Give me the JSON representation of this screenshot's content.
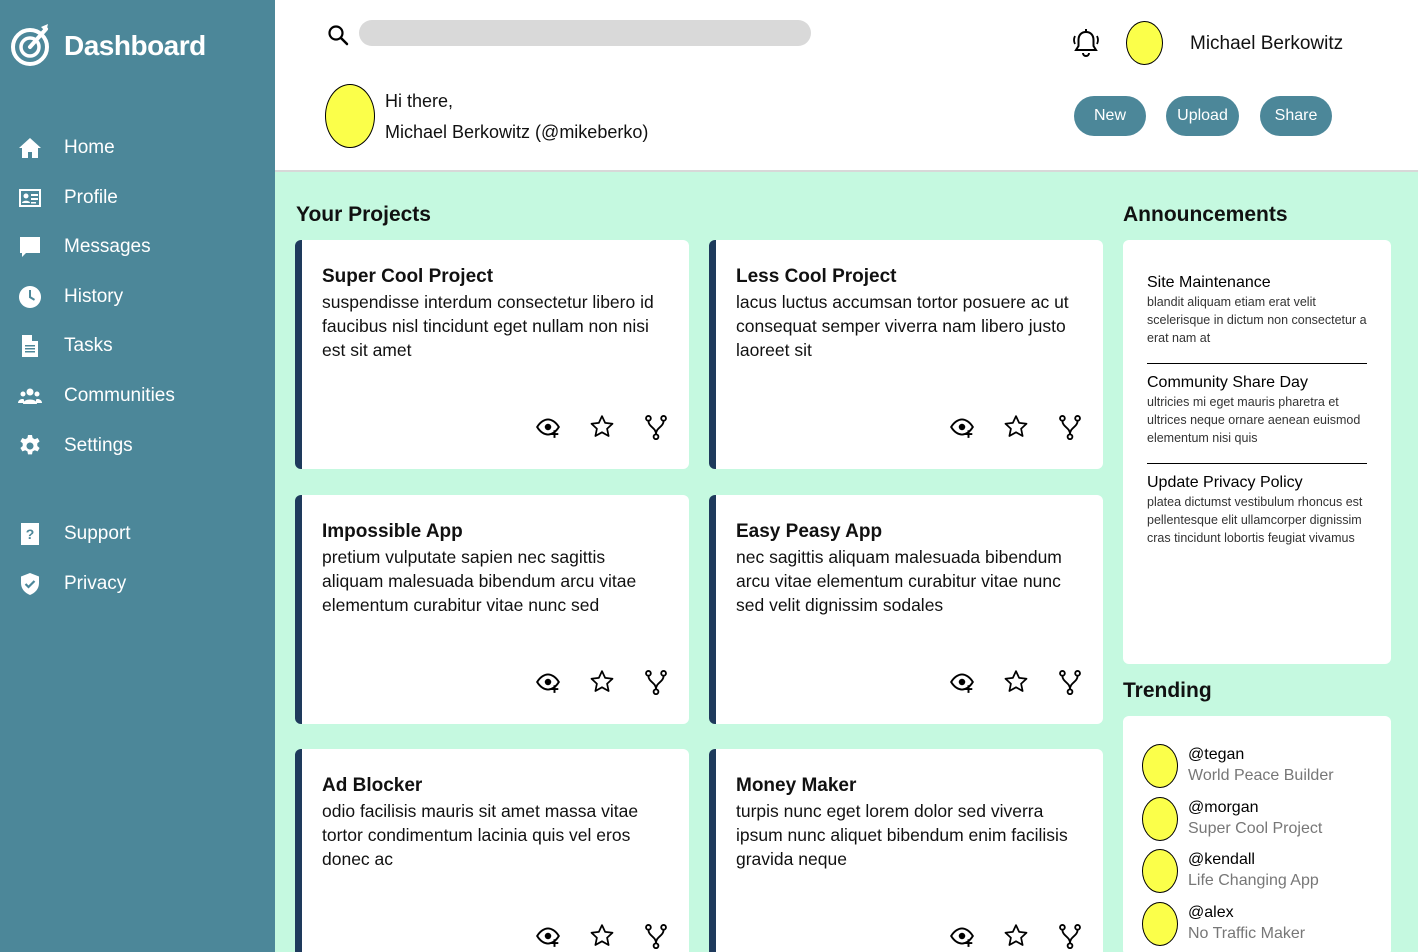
{
  "brand": {
    "title": "Dashboard"
  },
  "sidebar": {
    "main": [
      {
        "label": "Home",
        "icon": "home-icon"
      },
      {
        "label": "Profile",
        "icon": "profile-card-icon"
      },
      {
        "label": "Messages",
        "icon": "message-icon"
      },
      {
        "label": "History",
        "icon": "clock-icon"
      },
      {
        "label": "Tasks",
        "icon": "document-icon"
      },
      {
        "label": "Communities",
        "icon": "people-icon"
      },
      {
        "label": "Settings",
        "icon": "gear-icon"
      }
    ],
    "secondary": [
      {
        "label": "Support",
        "icon": "question-icon"
      },
      {
        "label": "Privacy",
        "icon": "shield-check-icon"
      }
    ]
  },
  "header": {
    "search_value": "",
    "user_name": "Michael Berkowitz",
    "greeting_line1": "Hi there,",
    "greeting_line2": "Michael Berkowitz (@mikeberko)",
    "buttons": {
      "new": "New",
      "upload": "Upload",
      "share": "Share"
    }
  },
  "main": {
    "projects_title": "Your Projects",
    "projects": [
      {
        "title": "Super Cool Project",
        "description": "suspendisse interdum consectetur libero id faucibus nisl tincidunt eget nullam non nisi est sit amet"
      },
      {
        "title": "Less Cool Project",
        "description": "lacus luctus accumsan tortor posuere ac ut consequat semper viverra nam libero justo laoreet sit"
      },
      {
        "title": "Impossible App",
        "description": "pretium vulputate sapien nec sagittis aliquam malesuada bibendum arcu vitae elementum curabitur vitae nunc sed"
      },
      {
        "title": "Easy Peasy App",
        "description": "nec sagittis aliquam malesuada bibendum arcu vitae elementum curabitur vitae nunc sed velit dignissim sodales"
      },
      {
        "title": "Ad Blocker",
        "description": "odio facilisis mauris sit amet massa vitae tortor condimentum lacinia quis vel eros donec ac"
      },
      {
        "title": "Money Maker",
        "description": "turpis nunc eget lorem dolor sed viverra ipsum nunc aliquet bibendum enim facilisis gravida neque"
      }
    ],
    "announcements_title": "Announcements",
    "announcements": [
      {
        "title": "Site Maintenance",
        "body": "blandit aliquam etiam erat velit scelerisque in dictum non consectetur a erat nam at"
      },
      {
        "title": "Community Share Day",
        "body": "ultricies mi eget mauris pharetra et ultrices neque ornare aenean euismod elementum nisi quis"
      },
      {
        "title": "Update Privacy Policy",
        "body": "platea dictumst vestibulum rhoncus est pellentesque elit ullamcorper dignissim cras tincidunt lobortis feugiat vivamus"
      }
    ],
    "trending_title": "Trending",
    "trending": [
      {
        "handle": "@tegan",
        "project": "World Peace Builder"
      },
      {
        "handle": "@morgan",
        "project": "Super Cool Project"
      },
      {
        "handle": "@kendall",
        "project": "Life Changing App"
      },
      {
        "handle": "@alex",
        "project": "No Traffic Maker"
      }
    ]
  },
  "colors": {
    "sidebar": "#4c8799",
    "main_bg": "#c5f9e0",
    "card_accent": "#1e3a5c",
    "avatar": "#fbff4a",
    "button": "#4c8799"
  }
}
